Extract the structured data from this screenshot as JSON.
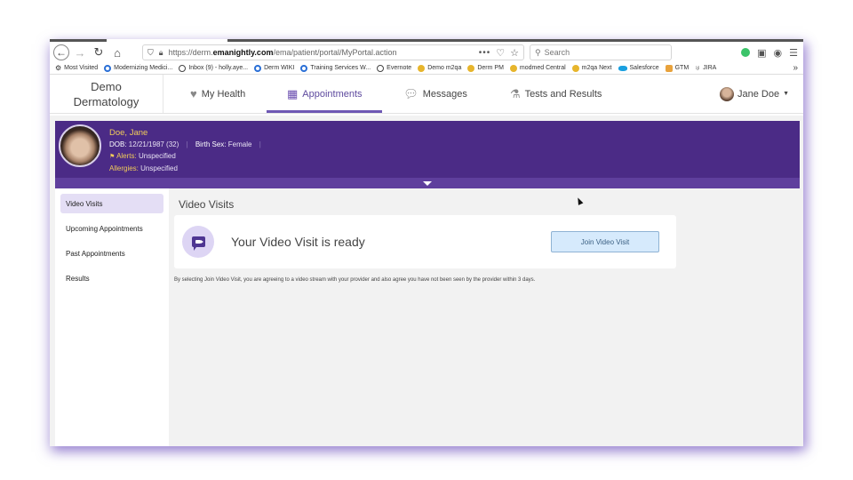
{
  "browser": {
    "url_prefix": "https://derm.",
    "url_domain": "emanightly.com",
    "url_path": "/ema/patient/portal/MyPortal.action",
    "url_actions": "•••",
    "search_placeholder": "Search",
    "nav": {
      "back": "←",
      "forward": "→",
      "reload": "↻",
      "home": "⌂"
    },
    "bookmarks": [
      {
        "label": "Most Visited",
        "icon": "gear-icon"
      },
      {
        "label": "Modernizing Medici...",
        "icon": "circle-icon"
      },
      {
        "label": "Inbox (9) - holly.aye...",
        "icon": "globe-icon"
      },
      {
        "label": "Derm WIKI",
        "icon": "circle-icon"
      },
      {
        "label": "Training Services W...",
        "icon": "circle-icon"
      },
      {
        "label": "Evernote",
        "icon": "globe-icon"
      },
      {
        "label": "Demo m2qa",
        "icon": "modmed-icon"
      },
      {
        "label": "Derm PM",
        "icon": "modmed-icon"
      },
      {
        "label": "modmed Central",
        "icon": "modmed-icon"
      },
      {
        "label": "m2qa Next",
        "icon": "modmed-icon"
      },
      {
        "label": "Salesforce",
        "icon": "salesforce-icon"
      },
      {
        "label": "GTM",
        "icon": "gtm-icon"
      },
      {
        "label": "JIRA",
        "icon": "jira-icon"
      }
    ],
    "bookmarks_more": "»"
  },
  "app": {
    "brand_line1": "Demo",
    "brand_line2": "Dermatology",
    "nav": [
      {
        "label": "My Health",
        "icon": "heart-icon"
      },
      {
        "label": "Appointments",
        "icon": "calendar-icon",
        "active": true
      },
      {
        "label": "Messages",
        "icon": "chat-icon"
      },
      {
        "label": "Tests and Results",
        "icon": "microscope-icon"
      }
    ],
    "user_name": "Jane Doe",
    "accent_color": "#6e58b4",
    "banner_color": "#4b2b86"
  },
  "patient": {
    "name": "Doe, Jane",
    "dob_label": "DOB:",
    "dob_value": "12/21/1987 (32)",
    "sex_label": "Birth Sex:",
    "sex_value": "Female",
    "alerts_label": "Alerts:",
    "alerts_value": "Unspecified",
    "allergies_label": "Allergies:",
    "allergies_value": "Unspecified"
  },
  "sidebar": {
    "items": [
      {
        "label": "Video Visits",
        "active": true
      },
      {
        "label": "Upcoming Appointments"
      },
      {
        "label": "Past Appointments"
      },
      {
        "label": "Results"
      }
    ]
  },
  "main": {
    "title": "Video Visits",
    "card_text": "Your Video Visit is ready",
    "join_button": "Join Video Visit",
    "disclaimer": "By selecting Join Video Visit, you are agreeing to a video stream with your provider and also agree you have not been seen by the provider within 3 days."
  }
}
